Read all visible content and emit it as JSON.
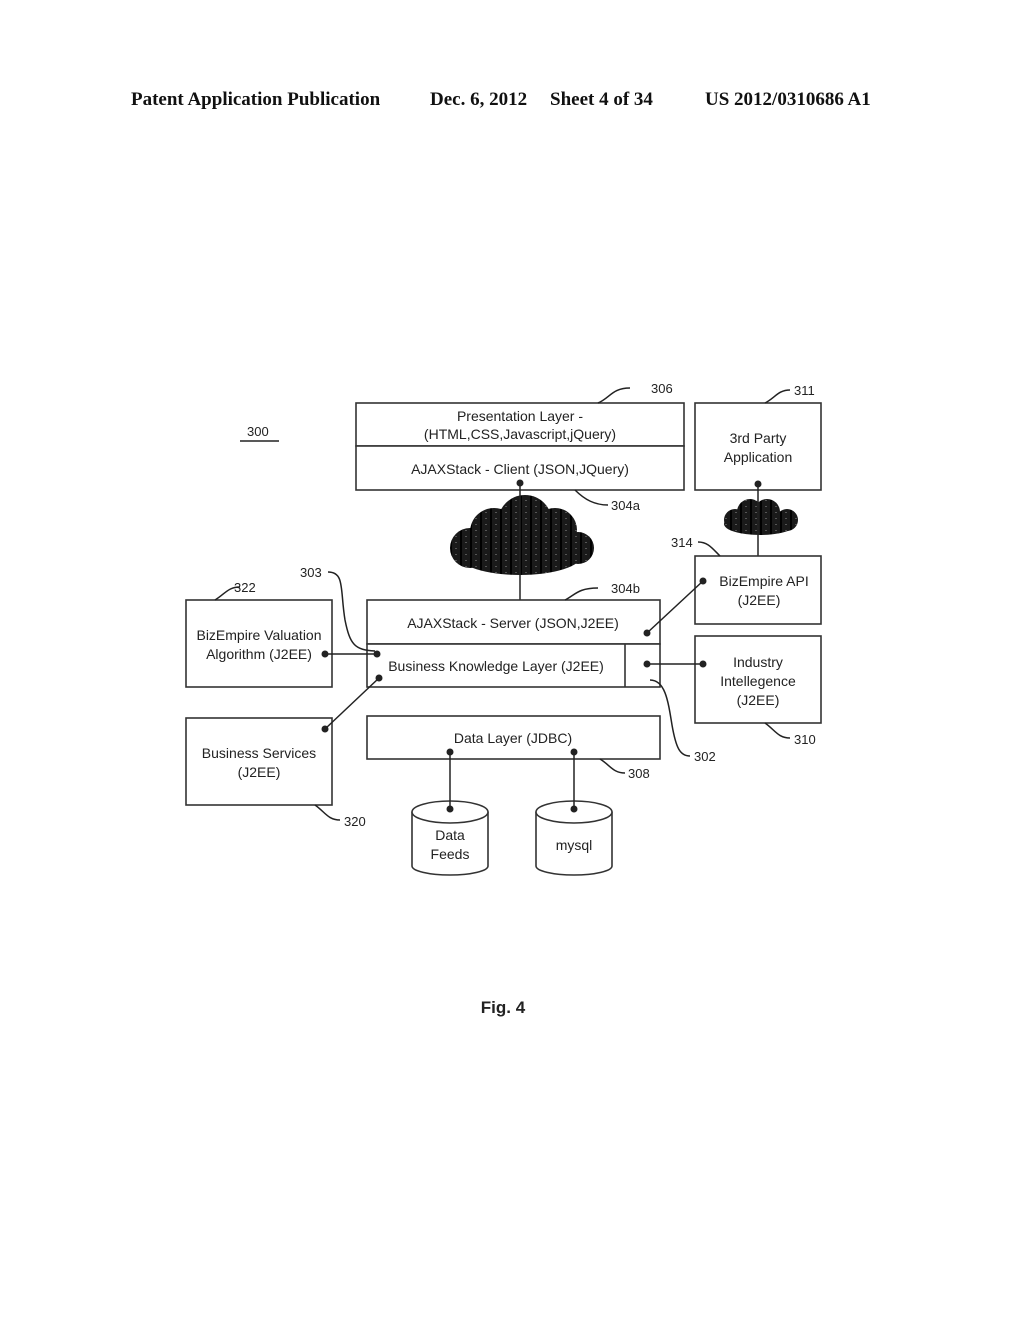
{
  "header": {
    "publication": "Patent Application Publication",
    "date": "Dec. 6, 2012",
    "sheet": "Sheet 4 of 34",
    "number": "US 2012/0310686 A1"
  },
  "figure": {
    "id_label": "300",
    "caption": "Fig. 4"
  },
  "boxes": {
    "presentation_line1": "Presentation Layer -",
    "presentation_line2": "(HTML,CSS,Javascript,jQuery)",
    "ajax_client": "AJAXStack - Client (JSON,JQuery)",
    "third_party_line1": "3rd Party",
    "third_party_line2": "Application",
    "ajax_server": "AJAXStack - Server (JSON,J2EE)",
    "business_knowledge": "Business Knowledge Layer (J2EE)",
    "valuation_line1": "BizEmpire Valuation",
    "valuation_line2": "Algorithm (J2EE)",
    "api_line1": "BizEmpire API",
    "api_line2": "(J2EE)",
    "industry_line1": "Industry",
    "industry_line2": "Intellegence",
    "industry_line3": "(J2EE)",
    "business_services_line1": "Business Services",
    "business_services_line2": "(J2EE)",
    "data_layer": "Data Layer (JDBC)",
    "data_feeds_line1": "Data",
    "data_feeds_line2": "Feeds",
    "mysql": "mysql"
  },
  "refs": {
    "r306": "306",
    "r311": "311",
    "r304a": "304a",
    "r314": "314",
    "r303": "303",
    "r322": "322",
    "r304b": "304b",
    "r302": "302",
    "r310": "310",
    "r308": "308",
    "r320": "320"
  }
}
